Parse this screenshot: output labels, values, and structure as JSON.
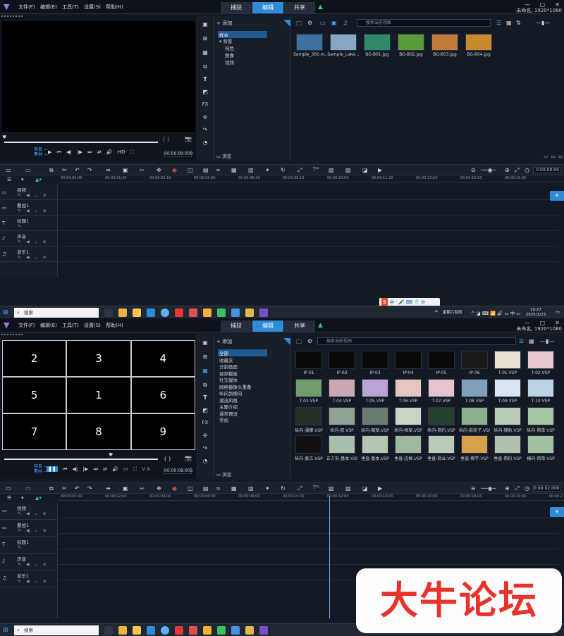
{
  "menu": {
    "items": [
      "文件(F)",
      "编辑(E)",
      "工具(T)",
      "设置(S)",
      "帮助(H)"
    ]
  },
  "mode_tabs": [
    "捕获",
    "编辑",
    "共享"
  ],
  "active_mode": "编辑",
  "project_info": "未命名, 1920*1080",
  "preview": {
    "mode_project": "项目 —",
    "mode_clip": "素材 —",
    "timecode": "00:00:00:000",
    "timecode2": "00:00:08:005",
    "hd_label": "HD"
  },
  "library_nav_1": {
    "add": "添加",
    "items": [
      "样本",
      "背景",
      "纯色",
      "图像",
      "视频"
    ],
    "browse": "浏览"
  },
  "library_nav_2": {
    "add": "添加",
    "items": [
      "全部",
      "收藏夹",
      "分割画面",
      "视频模板",
      "社交媒体",
      "网络摄像头重叠",
      "纵向到横向",
      "潮流风格",
      "主题介绍",
      "通常预设",
      "常规"
    ],
    "browse": "浏览"
  },
  "search_placeholder": "搜索当前视图",
  "thumbs_1": [
    {
      "label": "Sample_360.m...",
      "color": "#3d6fa0"
    },
    {
      "label": "Sample_Lake...",
      "color": "#8aa6c4"
    },
    {
      "label": "BG-B01.jpg",
      "color": "#2f8a6a"
    },
    {
      "label": "BG-B02.jpg",
      "color": "#5a9c3a"
    },
    {
      "label": "BG-B03.jpg",
      "color": "#c07a3a"
    },
    {
      "label": "BG-B04.jpg",
      "color": "#c98a2c"
    }
  ],
  "thumbs_2": [
    {
      "label": "IP-01",
      "color": "#0a0a0a"
    },
    {
      "label": "IP-02",
      "color": "#0a0a0a"
    },
    {
      "label": "IP-03",
      "color": "#0a0a0a"
    },
    {
      "label": "IP-04",
      "color": "#0a0a0a"
    },
    {
      "label": "IP-05",
      "color": "#0a0a0a"
    },
    {
      "label": "IP-06",
      "color": "#1a1a1a"
    },
    {
      "label": "T-01.VSP",
      "color": "#e9e2d3"
    },
    {
      "label": "T-02.VSP",
      "color": "#e6c9cf"
    },
    {
      "label": "T-03.VSP",
      "color": "#6f9c6a"
    },
    {
      "label": "T-04.VSP",
      "color": "#c9a7b4"
    },
    {
      "label": "T-05.VSP",
      "color": "#b7a3d6"
    },
    {
      "label": "T-06.VSP",
      "color": "#e6c6c0"
    },
    {
      "label": "T-07.VSP",
      "color": "#e5c3d1"
    },
    {
      "label": "T-08.VSP",
      "color": "#7fa0b6"
    },
    {
      "label": "T-09.VSP",
      "color": "#d6e7f2"
    },
    {
      "label": "T-10.VSP",
      "color": "#bcd3e6"
    },
    {
      "label": "纵向-薄膜.VSP",
      "color": "#243327"
    },
    {
      "label": "纵向-双.VSP",
      "color": "#8fa294"
    },
    {
      "label": "纵向-图案.VSP",
      "color": "#6b7d70"
    },
    {
      "label": "纵向-框架.VSP",
      "color": "#c7d6c4"
    },
    {
      "label": "纵向-简约.VSP",
      "color": "#26402e"
    },
    {
      "label": "纵向-影轮子.VSP",
      "color": "#8fb08e"
    },
    {
      "label": "纵向-辅助.VSP",
      "color": "#b8cdb4"
    },
    {
      "label": "纵向-简单.VSP",
      "color": "#a8c7a6"
    },
    {
      "label": "纵向-复古.VSP",
      "color": "#111"
    },
    {
      "label": "正方形-基本.VSP",
      "color": "#a9bfae"
    },
    {
      "label": "垂直-基本.VSP",
      "color": "#b4c6b2"
    },
    {
      "label": "垂直-边框.VSP",
      "color": "#9fb89d"
    },
    {
      "label": "垂直-商业.VSP",
      "color": "#b9cbb6"
    },
    {
      "label": "垂直-教学.VSP",
      "color": "#d9a04a"
    },
    {
      "label": "垂直-简约.VSP",
      "color": "#b0c2ad"
    },
    {
      "label": "横向-简单.VSP",
      "color": "#a4c0a2"
    }
  ],
  "grid_numbers": [
    "2",
    "3",
    "4",
    "5",
    "1",
    "6",
    "7",
    "8",
    "9"
  ],
  "tracks": [
    {
      "name": "视频",
      "icon": "video-track-icon"
    },
    {
      "name": "叠加1",
      "icon": "overlay-track-icon"
    },
    {
      "name": "标题1",
      "icon": "title-track-icon"
    },
    {
      "name": "声音",
      "icon": "voice-track-icon"
    },
    {
      "name": "音乐1",
      "icon": "music-track-icon"
    }
  ],
  "ruler_1": [
    "00:00:00:00",
    "00:00:01:20",
    "00:00:03:10",
    "00:00:05:00",
    "00:00:06:20",
    "00:00:08:10",
    "00:00:10:00",
    "00:00:11:20",
    "00:00:13:10",
    "00:00:15:00",
    "00:00:16:20"
  ],
  "ruler_2": [
    "00:00:00:00",
    "00:00:02:00",
    "00:00:04:00",
    "00:00:06:00",
    "00:00:08:00",
    "00:00:10:00",
    "00:00:12:00",
    "00:00:14:00",
    "00:00:16:00",
    "00:00:18:00",
    "00:00:20:00",
    "00:00:2"
  ],
  "timeline_timecode_1": "0:00:00:00",
  "timeline_timecode_2": "0:00:02:000",
  "taskbar": {
    "search": "搜索",
    "weather": "星期六有雨",
    "time": "10:27",
    "date": "2025/1/23"
  },
  "ime": {
    "brand": "S",
    "text": "中 · 🎤 ⌨ 👕 ⚙"
  },
  "watermark": "大牛论坛",
  "colors": {
    "accent": "#2f8ad8",
    "bg": "#141a25",
    "brand_purple": "#a678e8"
  }
}
